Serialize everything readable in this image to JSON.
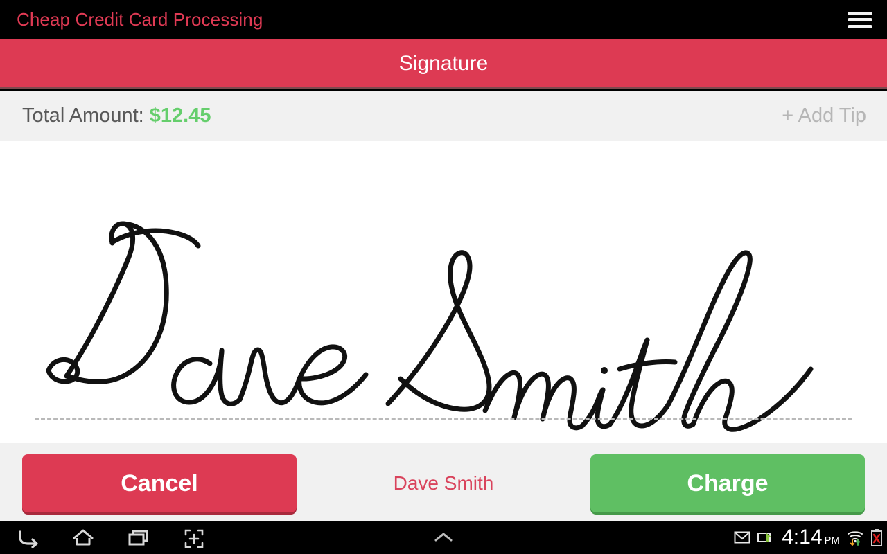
{
  "appbar": {
    "title": "Cheap Credit Card Processing",
    "menu_icon": "hamburger-menu-icon",
    "background": "#000000",
    "title_color": "#e03a54"
  },
  "titlebar": {
    "text": "Signature",
    "background": "#dd3a53",
    "text_color": "#ffffff"
  },
  "amountbar": {
    "label": "Total Amount:",
    "value": "$12.45",
    "value_color": "#65ce6c",
    "add_tip_label": "+ Add Tip",
    "add_tip_color": "#b6b6b6",
    "background": "#f1f1f1"
  },
  "signature": {
    "captured_name": "Dave Smith",
    "ink_color": "#111111",
    "canvas_background": "#ffffff",
    "baseline_style": "dashed",
    "baseline_color": "#b9b9b9"
  },
  "actionbar": {
    "cancel_label": "Cancel",
    "cancel_color": "#dd3a53",
    "signer_name": "Dave Smith",
    "signer_name_color": "#d9435c",
    "charge_label": "Charge",
    "charge_color": "#5fbf63",
    "background": "#f1f1f1"
  },
  "navbar": {
    "background": "#000000",
    "buttons": [
      {
        "name": "back-icon",
        "label": "Back"
      },
      {
        "name": "home-icon",
        "label": "Home"
      },
      {
        "name": "recents-icon",
        "label": "Recent apps"
      },
      {
        "name": "screenshot-icon",
        "label": "Screenshot"
      }
    ],
    "center_button": {
      "name": "chevron-up-icon",
      "label": "Expand"
    },
    "status": {
      "gmail_icon": "gmail-icon",
      "cast_icon": "screen-share-icon",
      "time": "4:14",
      "ampm": "PM",
      "wifi_icon": "wifi-transfer-icon",
      "battery_icon": "battery-error-icon"
    }
  }
}
